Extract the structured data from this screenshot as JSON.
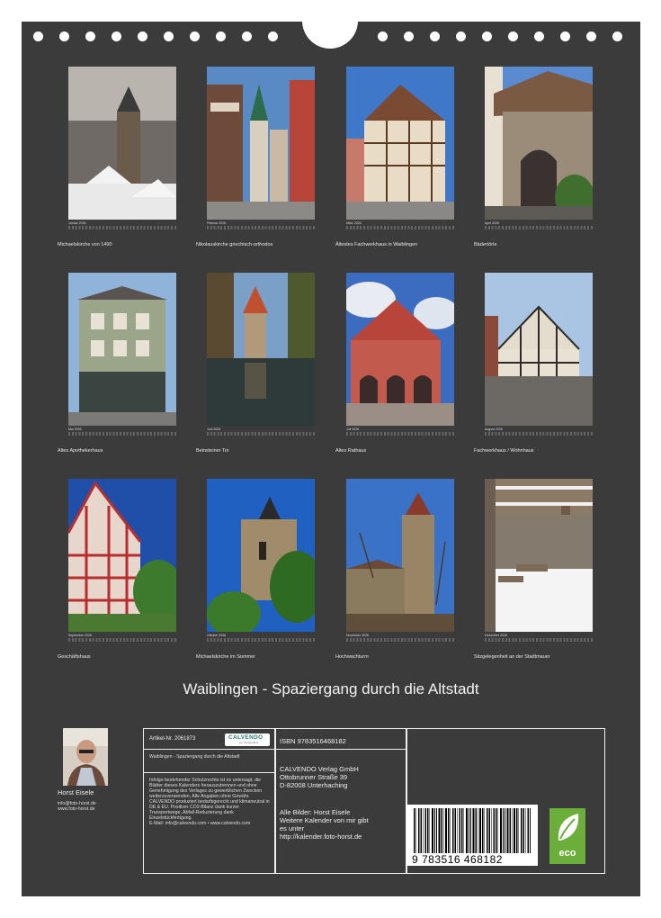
{
  "title": "Waiblingen - Spaziergang durch die Altstadt",
  "months": [
    {
      "month": "Januar 2026",
      "caption": "Michaelskirche von 1490"
    },
    {
      "month": "Februar 2026",
      "caption": "Nikolauskirche griechisch-orthodox"
    },
    {
      "month": "März 2026",
      "caption": "Ältestes Fachwerkhaus in Waiblingen"
    },
    {
      "month": "April 2026",
      "caption": "Bädertörle"
    },
    {
      "month": "Mai 2026",
      "caption": "Altes Apothekerhaus"
    },
    {
      "month": "Juni 2026",
      "caption": "Beinsteiner Tor"
    },
    {
      "month": "Juli 2026",
      "caption": "Altes Rathaus"
    },
    {
      "month": "August 2026",
      "caption": "Fachwerkhaus / Wohnhaus"
    },
    {
      "month": "September 2026",
      "caption": "Geschäftshaus"
    },
    {
      "month": "Oktober 2026",
      "caption": "Michaelskirche im Sommer"
    },
    {
      "month": "November 2026",
      "caption": "Hochwachturm"
    },
    {
      "month": "Dezember 2026",
      "caption": "Sitzgelegenheit an der Stadtmauer"
    }
  ],
  "author": {
    "name": "Horst Eisele",
    "email": "info@foto-horst.de",
    "web": "www.foto-horst.de"
  },
  "info": {
    "article": "Artikel-Nr. 2061873",
    "logo": "CALVENDO",
    "logo_sub": "ein Verlagslabel",
    "product_title": "Waiblingen - Spaziergang durch die Altstadt",
    "legal": "Infolge bestehender Schutzrechte ist es untersagt, die Blätter dieses Kalenders herauszutrennen und ohne Genehmigung des Verlages zu gewerblichen Zwecken weiterzuverwenden. Alle Angaben ohne Gewähr. CALVENDO produziert bedarfsgerecht und klimaneutral in DE & EU. Positiver CO2-Bilanz dank kurzer Transportwege, Abfall-Reduzierung dank Einzelstückfertigung.",
    "contact": "E-Mail: info@calvendo.com • www.calvendo.com",
    "isbn": "ISBN 9783516468182",
    "publisher_1": "CALVENDO Verlag GmbH",
    "publisher_2": "Ottobrunner Straße 39",
    "publisher_3": "D-82008 Unterhaching",
    "credits_1": "Alle Bilder: Horst Eisele",
    "credits_2": "Weitere Kalender von mir gibt",
    "credits_3": "es unter",
    "credits_4": "http://kalender.foto-horst.de",
    "barcode_number": "9 783516 468182",
    "eco_label": "eco"
  }
}
